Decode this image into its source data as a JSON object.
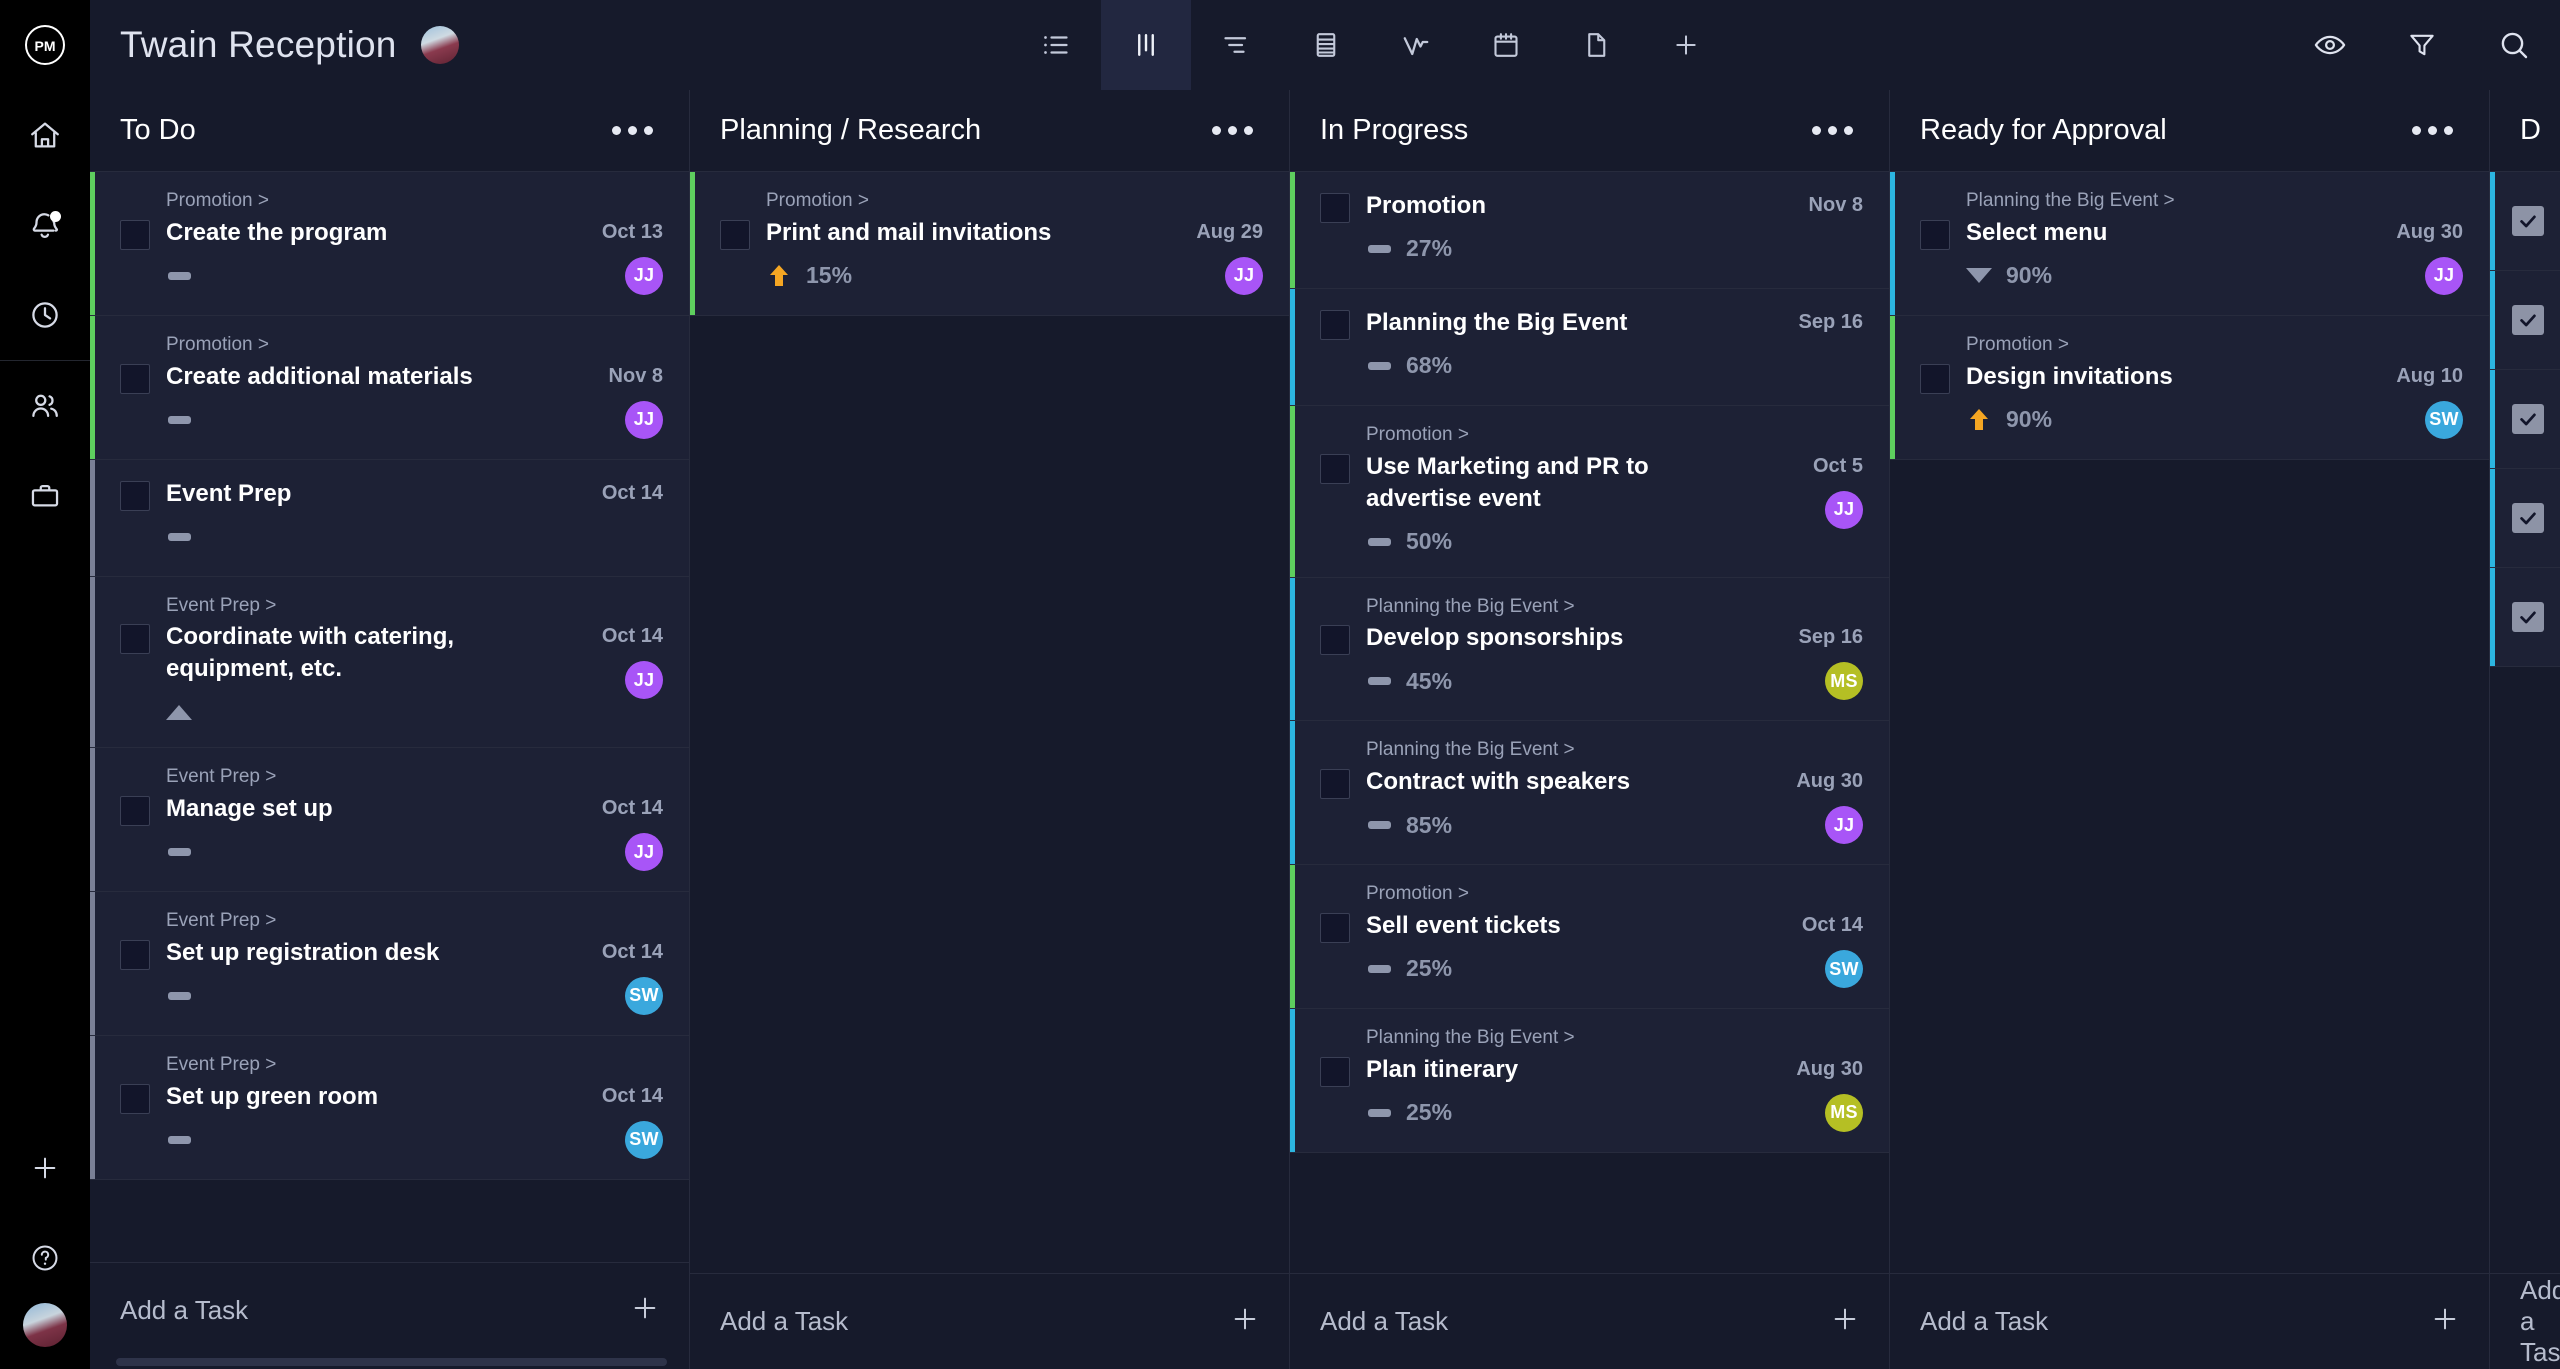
{
  "app": {
    "logo_text": "PM",
    "logo_name": "projectmanager-logo"
  },
  "topbar": {
    "project_title": "Twain Reception",
    "avatar_name": "project-owner-avatar",
    "views": [
      {
        "id": "list",
        "label": "List",
        "icon": "list-view-icon",
        "active": false
      },
      {
        "id": "board",
        "label": "Board",
        "icon": "board-view-icon",
        "active": true
      },
      {
        "id": "gantt",
        "label": "Gantt",
        "icon": "gantt-view-icon",
        "active": false
      },
      {
        "id": "sheet",
        "label": "Sheet",
        "icon": "sheet-view-icon",
        "active": false
      },
      {
        "id": "workload",
        "label": "Workload",
        "icon": "workload-view-icon",
        "active": false
      },
      {
        "id": "calendar",
        "label": "Calendar",
        "icon": "calendar-view-icon",
        "active": false
      },
      {
        "id": "pages",
        "label": "Pages",
        "icon": "page-view-icon",
        "active": false
      },
      {
        "id": "addview",
        "label": "Add View",
        "icon": "plus-icon",
        "active": false
      }
    ],
    "actions": [
      {
        "id": "visibility",
        "label": "Visibility",
        "icon": "eye-icon"
      },
      {
        "id": "filter",
        "label": "Filter",
        "icon": "filter-icon"
      },
      {
        "id": "search",
        "label": "Search",
        "icon": "search-icon"
      }
    ]
  },
  "rail": {
    "items": [
      {
        "id": "home",
        "label": "Home",
        "icon": "home-icon",
        "badge": false
      },
      {
        "id": "inbox",
        "label": "Notifications",
        "icon": "bell-icon",
        "badge": true
      },
      {
        "id": "timesheets",
        "label": "Timesheets",
        "icon": "clock-icon",
        "badge": false
      },
      {
        "id": "people",
        "label": "People",
        "icon": "people-icon",
        "badge": false
      },
      {
        "id": "projects",
        "label": "Projects",
        "icon": "briefcase-icon",
        "badge": false
      }
    ],
    "bottom": [
      {
        "id": "create",
        "label": "Create",
        "icon": "plus-icon"
      },
      {
        "id": "help",
        "label": "Help",
        "icon": "help-circle-icon"
      }
    ],
    "avatar_name": "user-avatar"
  },
  "board": {
    "add_task_label": "Add a Task",
    "colors": {
      "accent_promotion": "#5ecf5e",
      "accent_planning": "#2cb5e0",
      "accent_parent": "#7a8096",
      "avatar_jj": "#a855f7",
      "avatar_sw": "#3aa8dd",
      "avatar_ms": "#b5bf24",
      "priority_high": "#f5a623",
      "priority_none": "#8e96ac"
    },
    "columns": [
      {
        "id": "todo",
        "title": "To Do",
        "partial": false,
        "cards": [
          {
            "breadcrumb": "Promotion >",
            "title": "Create the program",
            "date": "Oct 13",
            "priority": "none",
            "pct": "",
            "assignee": "JJ",
            "assignee_color": "#a855f7",
            "accent": "#5ecf5e"
          },
          {
            "breadcrumb": "Promotion >",
            "title": "Create additional materials",
            "date": "Nov 8",
            "priority": "none",
            "pct": "",
            "assignee": "JJ",
            "assignee_color": "#a855f7",
            "accent": "#5ecf5e"
          },
          {
            "breadcrumb": "",
            "title": "Event Prep",
            "date": "Oct 14",
            "priority": "none",
            "pct": "",
            "assignee": "",
            "assignee_color": "",
            "accent": "#7a8096"
          },
          {
            "breadcrumb": "Event Prep >",
            "title": "Coordinate with catering, equipment, etc.",
            "date": "Oct 14",
            "priority": "med",
            "pct": "",
            "assignee": "JJ",
            "assignee_color": "#a855f7",
            "accent": "#7a8096"
          },
          {
            "breadcrumb": "Event Prep >",
            "title": "Manage set up",
            "date": "Oct 14",
            "priority": "none",
            "pct": "",
            "assignee": "JJ",
            "assignee_color": "#a855f7",
            "accent": "#7a8096"
          },
          {
            "breadcrumb": "Event Prep >",
            "title": "Set up registration desk",
            "date": "Oct 14",
            "priority": "none",
            "pct": "",
            "assignee": "SW",
            "assignee_color": "#3aa8dd",
            "accent": "#7a8096"
          },
          {
            "breadcrumb": "Event Prep >",
            "title": "Set up green room",
            "date": "Oct 14",
            "priority": "none",
            "pct": "",
            "assignee": "SW",
            "assignee_color": "#3aa8dd",
            "accent": "#7a8096"
          }
        ]
      },
      {
        "id": "planning-research",
        "title": "Planning / Research",
        "partial": false,
        "cards": [
          {
            "breadcrumb": "Promotion >",
            "title": "Print and mail invitations",
            "date": "Aug 29",
            "priority": "high",
            "pct": "15%",
            "assignee": "JJ",
            "assignee_color": "#a855f7",
            "accent": "#5ecf5e"
          }
        ]
      },
      {
        "id": "in-progress",
        "title": "In Progress",
        "partial": false,
        "cards": [
          {
            "breadcrumb": "",
            "title": "Promotion",
            "date": "Nov 8",
            "priority": "none",
            "pct": "27%",
            "assignee": "",
            "assignee_color": "",
            "accent": "#5ecf5e"
          },
          {
            "breadcrumb": "",
            "title": "Planning the Big Event",
            "date": "Sep 16",
            "priority": "none",
            "pct": "68%",
            "assignee": "",
            "assignee_color": "",
            "accent": "#2cb5e0"
          },
          {
            "breadcrumb": "Promotion >",
            "title": "Use Marketing and PR to advertise event",
            "date": "Oct 5",
            "priority": "none",
            "pct": "50%",
            "assignee": "JJ",
            "assignee_color": "#a855f7",
            "accent": "#5ecf5e"
          },
          {
            "breadcrumb": "Planning the Big Event >",
            "title": "Develop sponsorships",
            "date": "Sep 16",
            "priority": "none",
            "pct": "45%",
            "assignee": "MS",
            "assignee_color": "#b5bf24",
            "accent": "#2cb5e0"
          },
          {
            "breadcrumb": "Planning the Big Event >",
            "title": "Contract with speakers",
            "date": "Aug 30",
            "priority": "none",
            "pct": "85%",
            "assignee": "JJ",
            "assignee_color": "#a855f7",
            "accent": "#2cb5e0"
          },
          {
            "breadcrumb": "Promotion >",
            "title": "Sell event tickets",
            "date": "Oct 14",
            "priority": "none",
            "pct": "25%",
            "assignee": "SW",
            "assignee_color": "#3aa8dd",
            "accent": "#5ecf5e"
          },
          {
            "breadcrumb": "Planning the Big Event >",
            "title": "Plan itinerary",
            "date": "Aug 30",
            "priority": "none",
            "pct": "25%",
            "assignee": "MS",
            "assignee_color": "#b5bf24",
            "accent": "#2cb5e0"
          }
        ]
      },
      {
        "id": "ready-for-approval",
        "title": "Ready for Approval",
        "partial": false,
        "cards": [
          {
            "breadcrumb": "Planning the Big Event >",
            "title": "Select menu",
            "date": "Aug 30",
            "priority": "low",
            "pct": "90%",
            "assignee": "JJ",
            "assignee_color": "#a855f7",
            "accent": "#2cb5e0"
          },
          {
            "breadcrumb": "Promotion >",
            "title": "Design invitations",
            "date": "Aug 10",
            "priority": "high",
            "pct": "90%",
            "assignee": "SW",
            "assignee_color": "#3aa8dd",
            "accent": "#5ecf5e"
          }
        ]
      },
      {
        "id": "done",
        "title": "Done",
        "partial": true,
        "completed_count": 5,
        "cards": []
      }
    ]
  }
}
